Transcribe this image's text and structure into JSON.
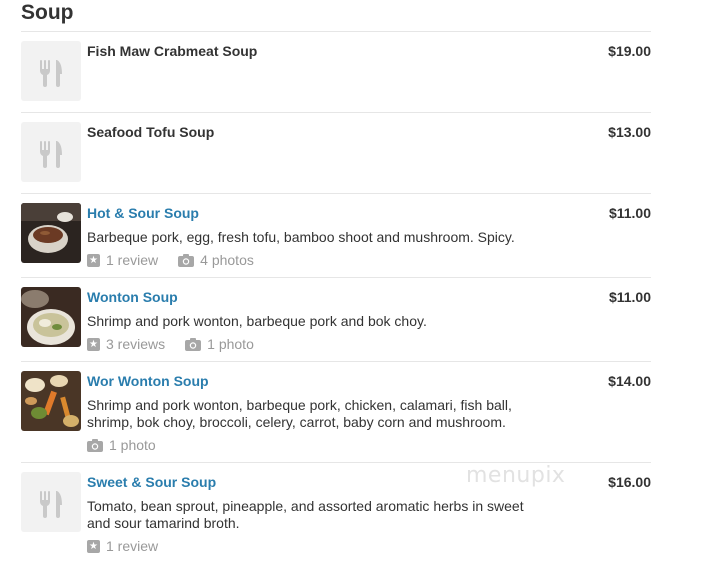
{
  "section": {
    "title": "Soup"
  },
  "items": [
    {
      "name": "Fish Maw Crabmeat Soup",
      "price": "$19.00",
      "description": "",
      "reviews": "",
      "photos": "",
      "thumb": "placeholder"
    },
    {
      "name": "Seafood Tofu Soup",
      "price": "$13.00",
      "description": "",
      "reviews": "",
      "photos": "",
      "thumb": "placeholder"
    },
    {
      "name": "Hot & Sour Soup",
      "price": "$11.00",
      "description": "Barbeque pork, egg, fresh tofu, bamboo shoot and mushroom. Spicy.",
      "reviews": "1 review",
      "photos": "4 photos",
      "thumb": "photo-hot-sour-soup"
    },
    {
      "name": "Wonton Soup",
      "price": "$11.00",
      "description": "Shrimp and pork wonton, barbeque pork and bok choy.",
      "reviews": "3 reviews",
      "photos": "1 photo",
      "thumb": "photo-wonton-soup"
    },
    {
      "name": "Wor Wonton Soup",
      "price": "$14.00",
      "description": "Shrimp and pork wonton, barbeque pork, chicken, calamari, fish ball, shrimp, bok choy, broccoli, celery, carrot, baby corn and mushroom.",
      "reviews": "",
      "photos": "1 photo",
      "thumb": "photo-wor-wonton-soup"
    },
    {
      "name": "Sweet & Sour Soup",
      "price": "$16.00",
      "description": "Tomato, bean sprout, pineapple, and assorted aromatic herbs in sweet and sour tamarind broth.",
      "reviews": "1 review",
      "photos": "",
      "thumb": "placeholder"
    }
  ],
  "watermark": "menupix",
  "colors": {
    "link": "#2a7dad",
    "text": "#333333",
    "muted": "#999999",
    "divider": "#e6e6e6"
  }
}
